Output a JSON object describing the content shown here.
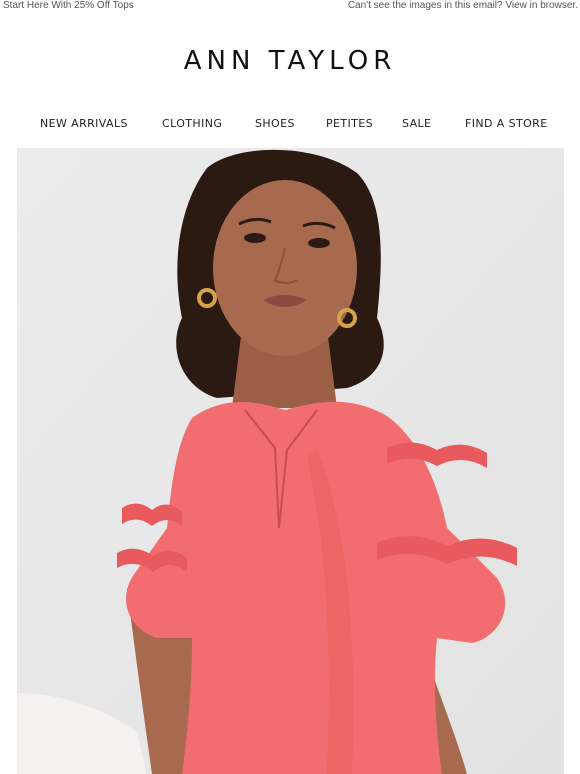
{
  "preheader": {
    "left_text": "Start Here With 25% Off Tops",
    "right_text": "Can't see the images in this email? View in browser."
  },
  "brand": {
    "logo": "ANN TAYLOR"
  },
  "nav": {
    "items": [
      {
        "label": "NEW ARRIVALS"
      },
      {
        "label": "CLOTHING"
      },
      {
        "label": "SHOES"
      },
      {
        "label": "PETITES"
      },
      {
        "label": "SALE"
      },
      {
        "label": "FIND A STORE"
      }
    ]
  },
  "hero": {
    "colors": {
      "background": "#eaeaea",
      "top_color": "#f26d6f",
      "skin": "#a86a4f",
      "hair": "#2a1a12"
    }
  }
}
